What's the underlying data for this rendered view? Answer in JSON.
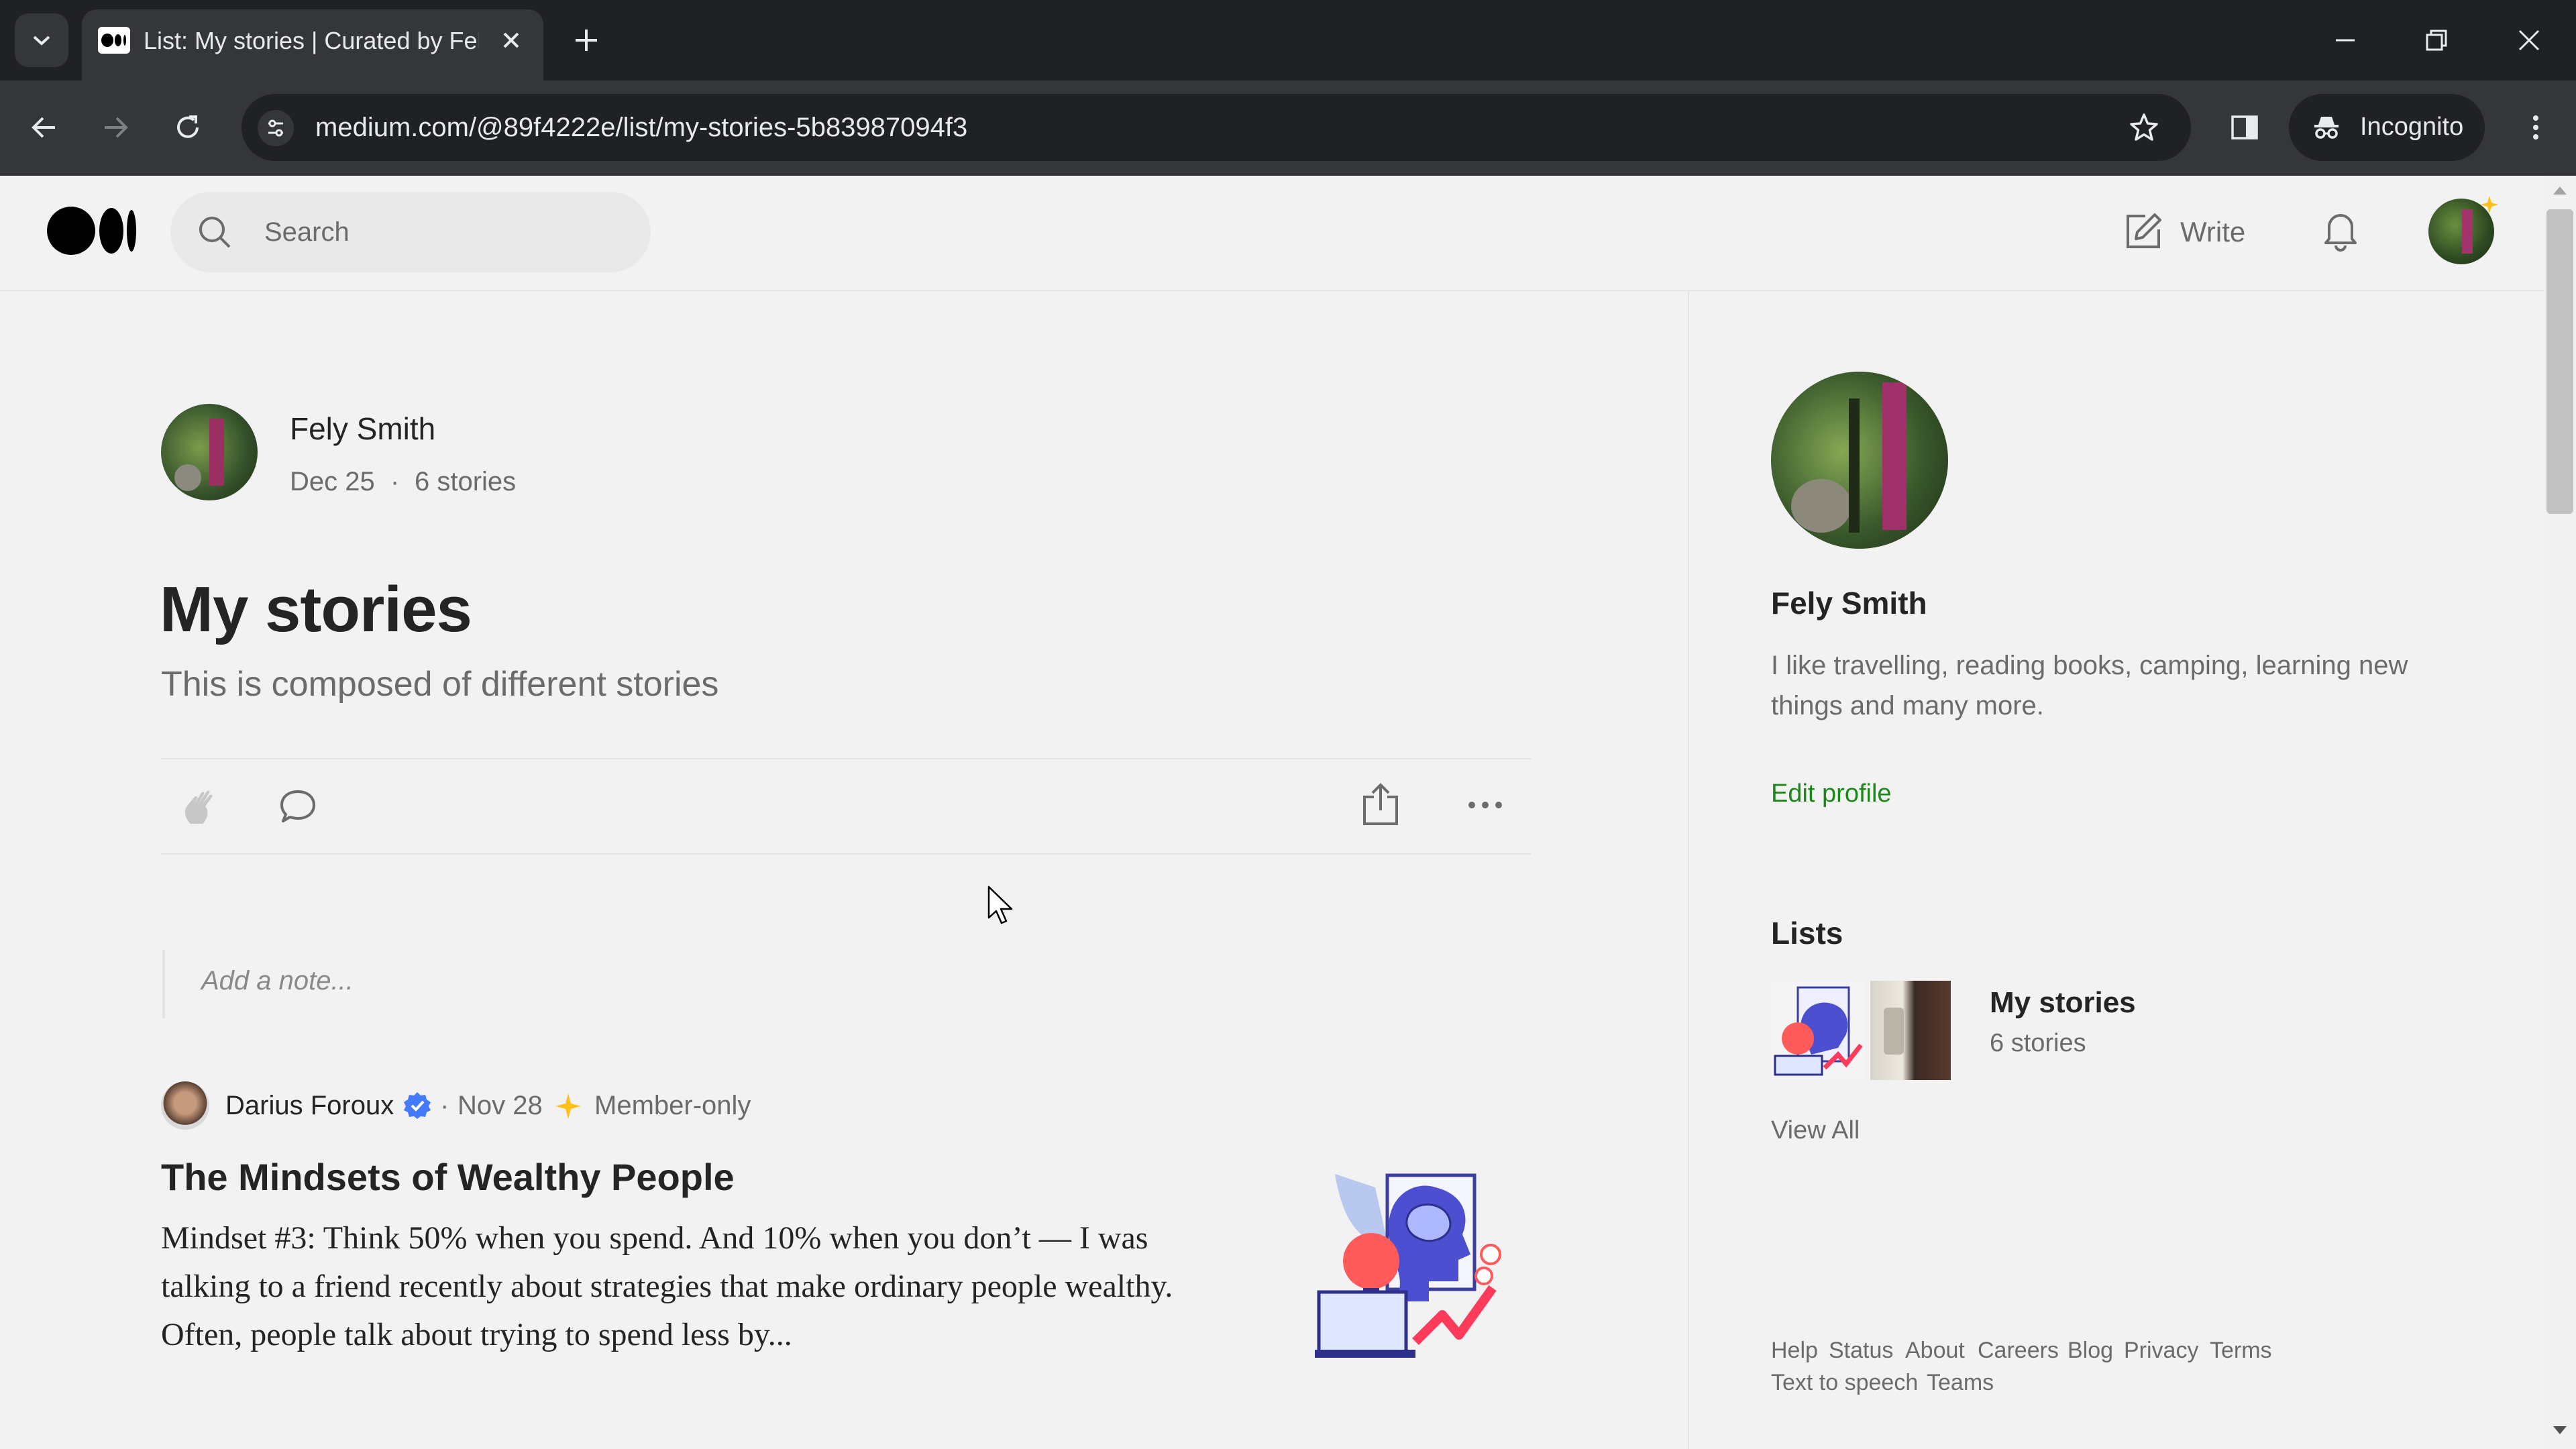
{
  "browser": {
    "tab_title": "List: My stories | Curated by Fely Smith",
    "url": "medium.com/@89f4222e/list/my-stories-5b83987094f3",
    "incognito_label": "Incognito"
  },
  "header": {
    "search_placeholder": "Search",
    "write_label": "Write"
  },
  "list": {
    "author": "Fely Smith",
    "date": "Dec 25",
    "separator": "·",
    "story_count": "6 stories",
    "title": "My stories",
    "description": "This is composed of different stories",
    "note_placeholder": "Add a note..."
  },
  "story": {
    "author": "Darius Foroux",
    "dot": "·",
    "date": "Nov 28",
    "member_label": "Member-only",
    "title": "The Mindsets of Wealthy People",
    "excerpt": "Mindset #3: Think 50% when you spend. And 10% when you don’t — I was talking to a friend recently about strategies that make ordinary people wealthy. Often, people talk about trying to spend less by..."
  },
  "sidebar": {
    "name": "Fely Smith",
    "bio": "I like travelling, reading books, camping, learning new things and many more.",
    "edit_profile": "Edit profile",
    "lists_heading": "Lists",
    "list_title": "My stories",
    "list_count": "6 stories",
    "view_all": "View All",
    "footer_links": [
      "Help",
      "Status",
      "About",
      "Careers",
      "Blog",
      "Privacy",
      "Terms",
      "Text to speech",
      "Teams"
    ]
  },
  "colors": {
    "accent_green": "#1a8917",
    "chrome_dark": "#202124",
    "chrome_mid": "#35363a",
    "member_star": "#ffc017"
  }
}
